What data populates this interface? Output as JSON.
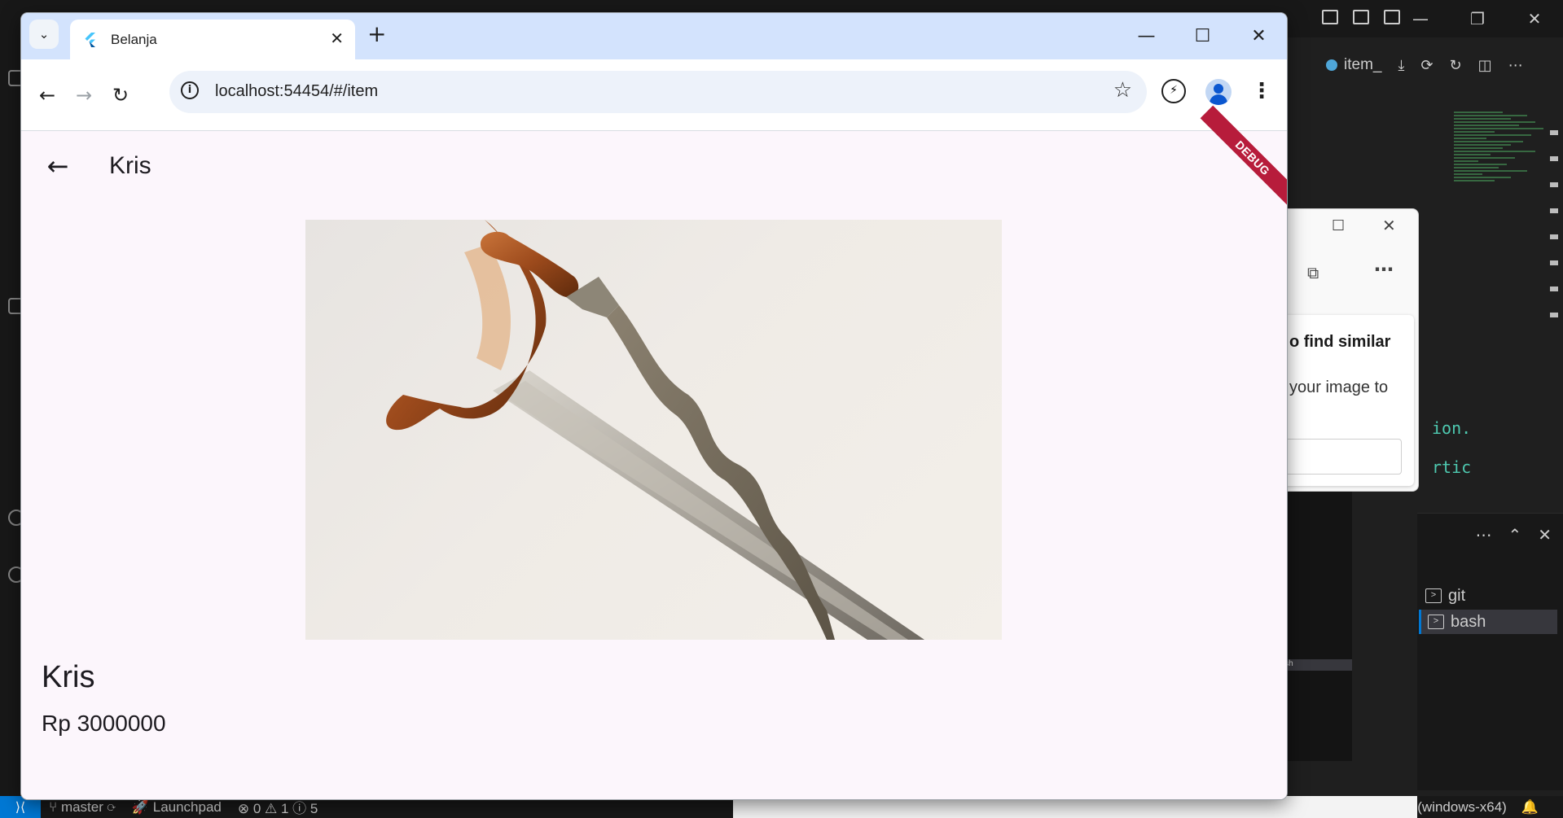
{
  "browser": {
    "tab_title": "Belanja",
    "url": "localhost:54454/#/item",
    "new_tab_glyph": "+",
    "minimize_glyph": "—",
    "maximize_glyph": "☐",
    "close_glyph": "✕"
  },
  "app": {
    "appbar_title": "Kris",
    "debug_banner": "DEBUG",
    "back_glyph": "←"
  },
  "product": {
    "name": "Kris",
    "price": "Rp 3000000",
    "image_icon": "kris-dagger-image"
  },
  "background": {
    "editor_tab": "item_",
    "code_fragment_1": "ion.",
    "code_fragment_2": "rtic",
    "edge_popup_title": "o find similar",
    "edge_popup_desc": "your image to",
    "terminals": [
      "git",
      "bash"
    ],
    "mini_terminals": [
      "git",
      "bash"
    ],
    "status": {
      "branch": "master",
      "launchpad": "Launchpad",
      "problems": "⊗ 0 ⚠ 1 ⓘ 5",
      "platform": "(windows-x64)"
    }
  },
  "colors": {
    "tabstrip": "#d3e3fd",
    "page_background": "#fcf6fc",
    "debug_banner": "#b71c3b",
    "vscode_bg": "#1f1f1f"
  }
}
